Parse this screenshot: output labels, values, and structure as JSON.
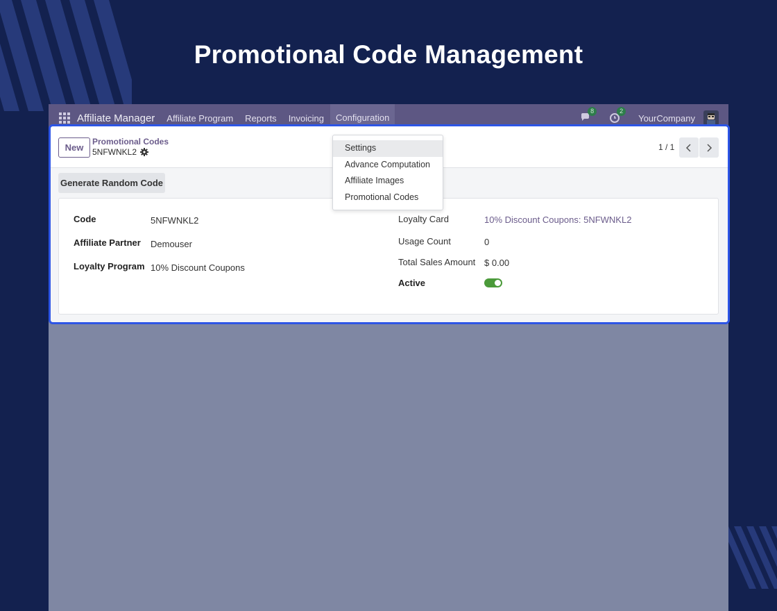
{
  "headline": "Promotional Code Management",
  "navbar": {
    "brand": "Affiliate Manager",
    "items": [
      "Affiliate Program",
      "Reports",
      "Invoicing",
      "Configuration"
    ],
    "active_item": "Configuration",
    "messages_count": "8",
    "activities_count": "2",
    "company": "YourCompany"
  },
  "control_panel": {
    "new_label": "New",
    "breadcrumb_parent": "Promotional Codes",
    "record_name": "5NFWNKL2",
    "pager": "1 / 1"
  },
  "actions": {
    "generate_label": "Generate Random Code"
  },
  "form": {
    "left": [
      {
        "label": "Code",
        "value": "5NFWNKL2"
      },
      {
        "label": "Affiliate Partner",
        "value": "Demouser"
      },
      {
        "label": "Loyalty Program",
        "value": "10% Discount Coupons"
      }
    ],
    "right": [
      {
        "label": "Loyalty Card",
        "value": "10% Discount Coupons: 5NFWNKL2"
      },
      {
        "label": "Usage Count",
        "value": "0"
      },
      {
        "label": "Total Sales Amount",
        "value": "$ 0.00"
      },
      {
        "label": "Active",
        "value": true
      }
    ]
  },
  "dropdown": {
    "items": [
      "Settings",
      "Advance Computation",
      "Affiliate Images",
      "Promotional Codes"
    ],
    "hovered": "Settings"
  },
  "colors": {
    "background": "#13214f",
    "navbar": "#5d5783",
    "accent": "#6b5c8b",
    "highlight_border": "#2d55e6",
    "toggle_on": "#4b9a3a"
  }
}
